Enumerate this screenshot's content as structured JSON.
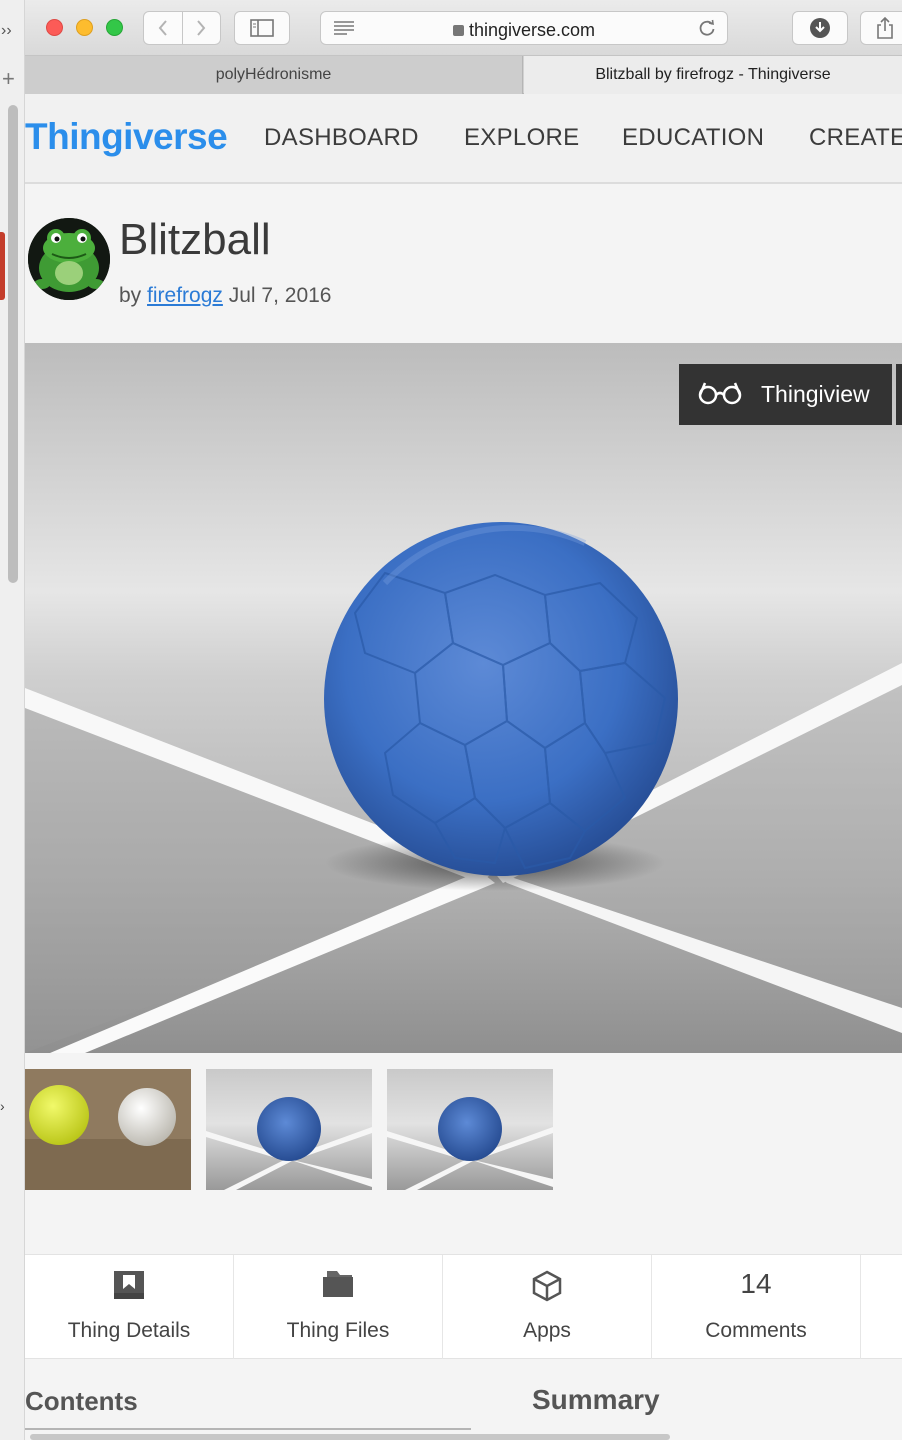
{
  "browser": {
    "url": "thingiverse.com",
    "tabs": [
      "polyHédronisme",
      "Blitzball by firefrogz - Thingiverse"
    ]
  },
  "site": {
    "logo": "Thingiverse",
    "nav": [
      "DASHBOARD",
      "EXPLORE",
      "EDUCATION",
      "CREATE"
    ]
  },
  "thing": {
    "title": "Blitzball",
    "by_label": "by",
    "author": "firefrogz",
    "date": "Jul 7, 2016",
    "viewer_button": "Thingiview"
  },
  "tabs": [
    {
      "label": "Thing Details",
      "icon": "thing-details-icon"
    },
    {
      "label": "Thing Files",
      "icon": "folder-icon"
    },
    {
      "label": "Apps",
      "icon": "cube-icon"
    },
    {
      "label": "Comments",
      "count": "14"
    }
  ],
  "sections": {
    "left": "Contents",
    "right": "Summary"
  },
  "colors": {
    "brand": "#2b8eeb",
    "ball": "#3b6fc4",
    "yellow_ball": "#d8e63a"
  }
}
